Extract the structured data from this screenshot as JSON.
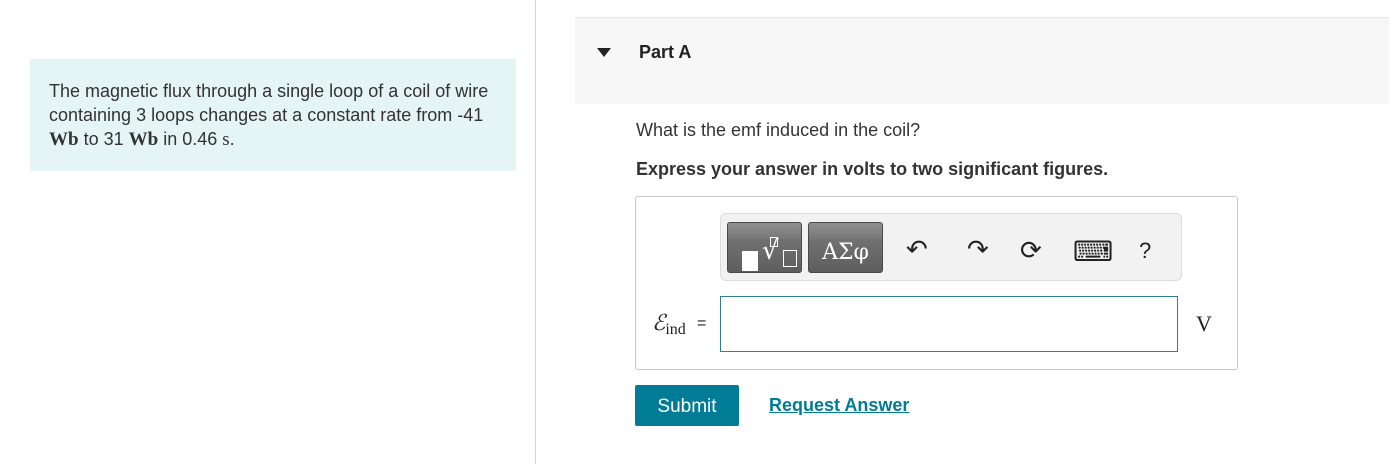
{
  "problem": {
    "t1": "The magnetic flux through a single loop of a coil of wire containing 3 loops changes at a constant rate from -41 ",
    "u1": "Wb",
    "t2": " to 31 ",
    "u2": "Wb",
    "t3": " in 0.46 ",
    "u3": "s",
    "t4": "."
  },
  "part": {
    "title": "Part A"
  },
  "question": "What is the emf induced in the coil?",
  "instruction": "Express your answer in volts to two significant figures.",
  "toolbar": {
    "symbols_label": "ΑΣφ",
    "undo_icon": "↶",
    "redo_icon": "↷",
    "reset_icon": "⟳",
    "keyboard_icon": "⌨",
    "help_label": "?"
  },
  "answer": {
    "variable": "ℰ",
    "subscript": "ind",
    "equals": "=",
    "value": "",
    "unit": "V"
  },
  "buttons": {
    "submit": "Submit",
    "request_answer": "Request Answer"
  },
  "colors": {
    "accent": "#007c97",
    "problem_bg": "#e5f4f5"
  }
}
